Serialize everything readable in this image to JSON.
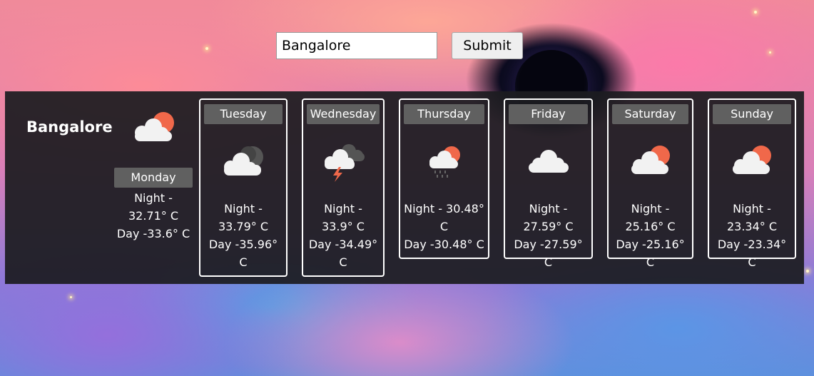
{
  "search": {
    "value": "Bangalore"
  },
  "submit_label": "Submit",
  "location": {
    "city": "Bangalore",
    "icon": "partly-cloudy-day-icon"
  },
  "today": {
    "day": "Monday",
    "night": "Night - 32.71° C",
    "dayTemp": "Day -33.6° C"
  },
  "forecast": [
    {
      "day": "Tuesday",
      "icon": "cloudy-night-icon",
      "night": "Night - 33.79° C",
      "dayTemp": "Day -35.96° C"
    },
    {
      "day": "Wednesday",
      "icon": "thunderstorm-icon",
      "night": "Night - 33.9° C",
      "dayTemp": "Day -34.49° C"
    },
    {
      "day": "Thursday",
      "icon": "rain-sun-cloud-icon",
      "night": "Night - 30.48° C",
      "dayTemp": "Day -30.48° C"
    },
    {
      "day": "Friday",
      "icon": "cloud-icon",
      "night": "Night - 27.59° C",
      "dayTemp": "Day -27.59° C"
    },
    {
      "day": "Saturday",
      "icon": "partly-cloudy-day-icon",
      "night": "Night - 25.16° C",
      "dayTemp": "Day -25.16° C"
    },
    {
      "day": "Sunday",
      "icon": "partly-cloudy-day-icon",
      "night": "Night - 23.34° C",
      "dayTemp": "Day -23.34° C"
    }
  ],
  "colors": {
    "sun": "#f0684a",
    "cloud": "#f2f2f2",
    "dark-cloud": "#555555",
    "bolt": "#f0684a",
    "rain": "#666666"
  }
}
